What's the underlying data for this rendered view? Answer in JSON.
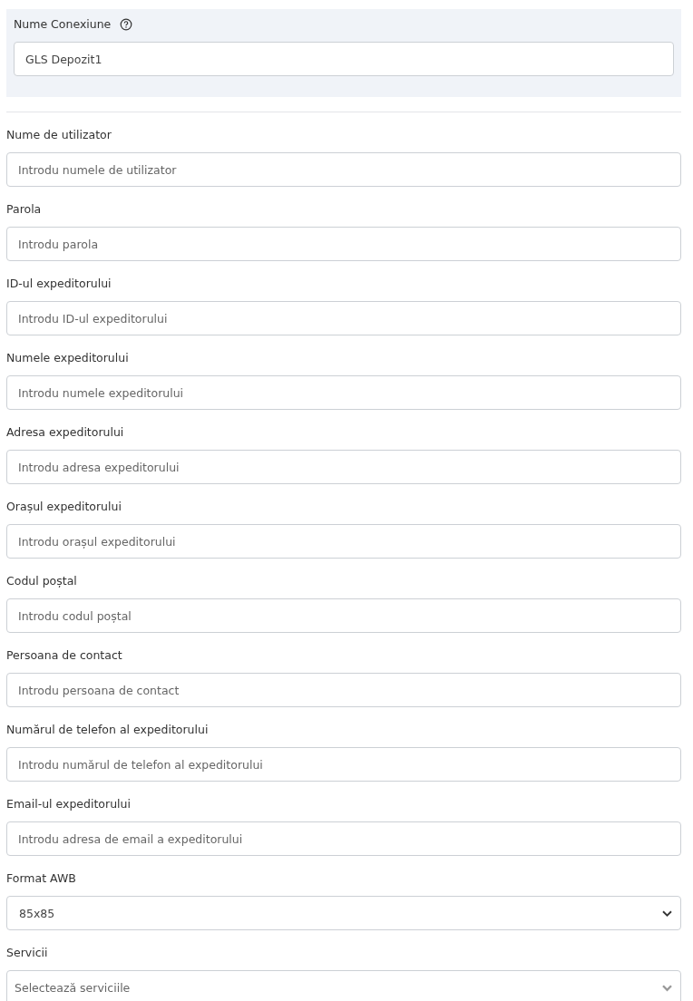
{
  "connection": {
    "label": "Nume Conexiune",
    "value": "GLS Depozit1"
  },
  "fields": [
    {
      "kind": "input",
      "label": "Nume de utilizator",
      "placeholder": "Introdu numele de utilizator"
    },
    {
      "kind": "input",
      "label": "Parola",
      "placeholder": "Introdu parola"
    },
    {
      "kind": "input",
      "label": "ID-ul expeditorului",
      "placeholder": "Introdu ID-ul expeditorului"
    },
    {
      "kind": "input",
      "label": "Numele expeditorului",
      "placeholder": "Introdu numele expeditorului"
    },
    {
      "kind": "input",
      "label": "Adresa expeditorului",
      "placeholder": "Introdu adresa expeditorului"
    },
    {
      "kind": "input",
      "label": "Orașul expeditorului",
      "placeholder": "Introdu orașul expeditorului"
    },
    {
      "kind": "input",
      "label": "Codul poștal",
      "placeholder": "Introdu codul poștal"
    },
    {
      "kind": "input",
      "label": "Persoana de contact",
      "placeholder": "Introdu persoana de contact"
    },
    {
      "kind": "input",
      "label": "Numărul de telefon al expeditorului",
      "placeholder": "Introdu numărul de telefon al expeditorului"
    },
    {
      "kind": "input",
      "label": "Email-ul expeditorului",
      "placeholder": "Introdu adresa de email a expeditorului"
    },
    {
      "kind": "select",
      "label": "Format AWB",
      "value": "85x85"
    },
    {
      "kind": "multiselect",
      "label": "Servicii",
      "placeholder": "Selectează serviciile"
    }
  ]
}
